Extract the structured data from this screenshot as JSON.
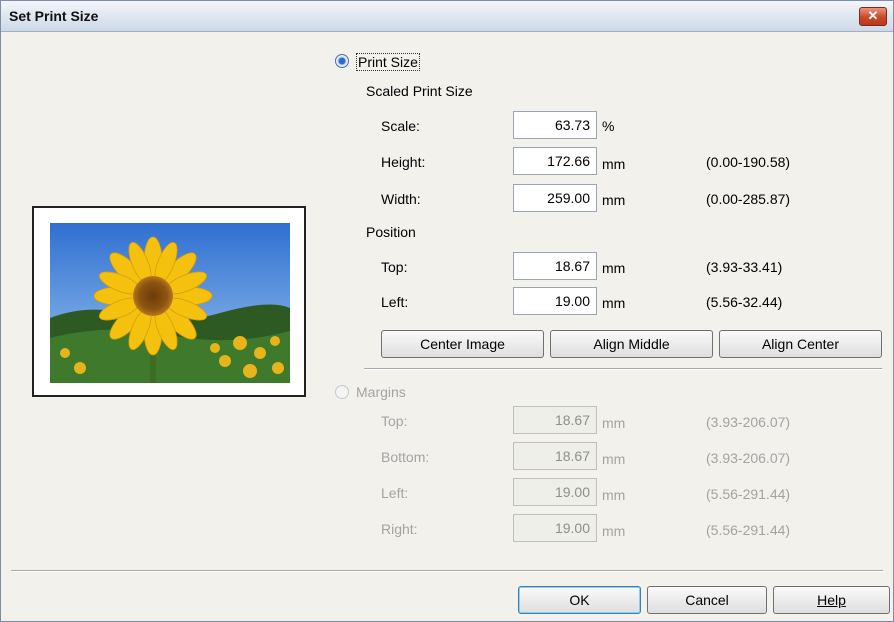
{
  "window": {
    "title": "Set Print Size",
    "close_glyph": "✕"
  },
  "print_size": {
    "radio_label": "Print Size",
    "selected": true,
    "scaled_heading": "Scaled Print Size",
    "scale": {
      "label": "Scale:",
      "value": "63.73",
      "unit": "%"
    },
    "height": {
      "label": "Height:",
      "value": "172.66",
      "unit": "mm",
      "range": "(0.00-190.58)"
    },
    "width": {
      "label": "Width:",
      "value": "259.00",
      "unit": "mm",
      "range": "(0.00-285.87)"
    },
    "position_heading": "Position",
    "top": {
      "label": "Top:",
      "value": "18.67",
      "unit": "mm",
      "range": "(3.93-33.41)"
    },
    "left": {
      "label": "Left:",
      "value": "19.00",
      "unit": "mm",
      "range": "(5.56-32.44)"
    },
    "buttons": {
      "center_image": "Center Image",
      "align_middle": "Align Middle",
      "align_center": "Align Center"
    }
  },
  "margins": {
    "radio_label": "Margins",
    "selected": false,
    "top": {
      "label": "Top:",
      "value": "18.67",
      "unit": "mm",
      "range": "(3.93-206.07)"
    },
    "bottom": {
      "label": "Bottom:",
      "value": "18.67",
      "unit": "mm",
      "range": "(3.93-206.07)"
    },
    "left": {
      "label": "Left:",
      "value": "19.00",
      "unit": "mm",
      "range": "(5.56-291.44)"
    },
    "right": {
      "label": "Right:",
      "value": "19.00",
      "unit": "mm",
      "range": "(5.56-291.44)"
    }
  },
  "footer": {
    "ok": "OK",
    "cancel": "Cancel",
    "help": "Help"
  },
  "colors": {
    "title_gradient_top": "#f4f6fa",
    "close_red": "#c9482b",
    "radio_blue": "#2e6bd0",
    "default_button_border": "#3c7fb1"
  },
  "icons": {
    "preview": "sunflower-photo"
  }
}
